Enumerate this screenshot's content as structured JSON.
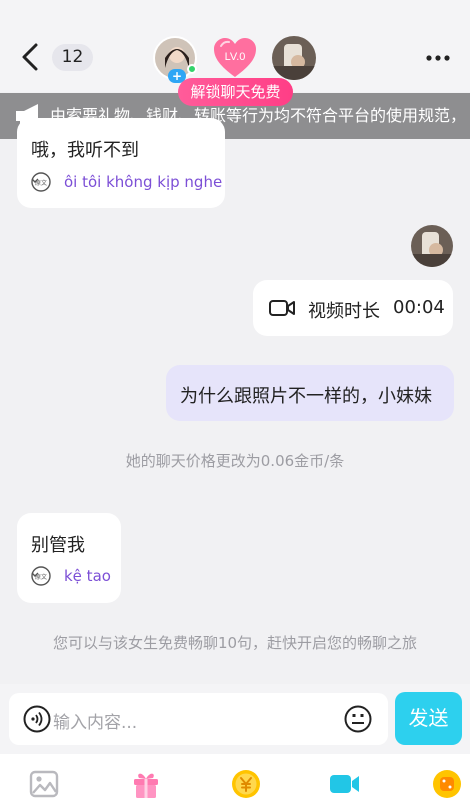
{
  "header": {
    "unread_count": "12",
    "level_badge": "LV.0",
    "unlock_label": "解锁聊天免费"
  },
  "notice": {
    "text": "由索要礼物、钱财、转账等行为均不符合平台的使用规范，"
  },
  "messages": {
    "m1_text": "哦，我听不到",
    "m1_translation": "ôi tôi không kịp nghe",
    "video_label": "视频时长",
    "video_duration": "00:04",
    "m3_text": "为什么跟照片不一样的，小妹妹",
    "system1": "她的聊天价格更改为0.06金币/条",
    "m4_text": "别管我",
    "m4_translation": "kệ tao",
    "system2": "您可以与该女生免费畅聊10句，赶快开启您的畅聊之旅",
    "translate_icon_label": "原文"
  },
  "composer": {
    "placeholder": "输入内容...",
    "send_label": "发送"
  },
  "icons": {
    "back": "chevron-left-icon",
    "more": "more-icon",
    "speaker": "megaphone-icon",
    "translate": "translate-icon",
    "video": "video-camera-icon",
    "voice": "voice-icon",
    "emoji": "emoji-icon",
    "image": "image-icon",
    "gift": "gift-icon",
    "coin": "coin-icon",
    "video_call": "video-call-icon",
    "game": "game-icon"
  },
  "colors": {
    "accent_send": "#2dd0ee",
    "unlock_pink": "#ff4d8d",
    "translation_purple": "#7c4fd6",
    "my_bubble": "#e6e4fa"
  }
}
